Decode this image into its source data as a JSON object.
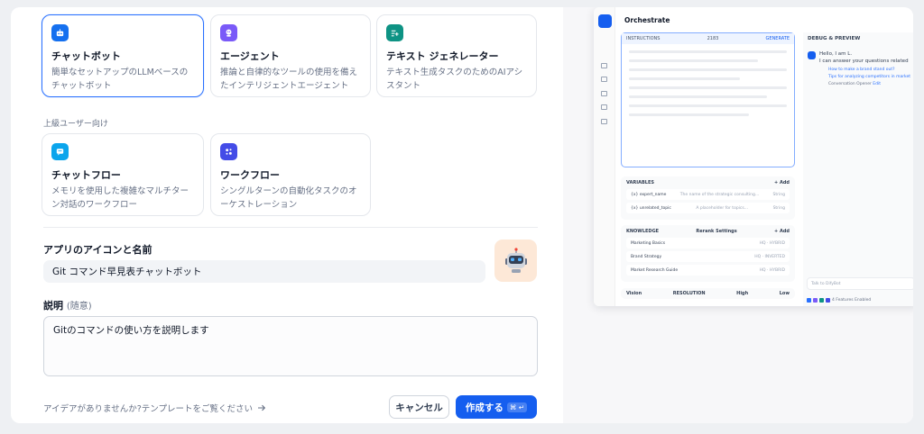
{
  "app_types": [
    {
      "title": "チャットボット",
      "desc": "簡単なセットアップのLLMベースのチャットボット",
      "color": "#1570ef",
      "icon": "chatbot-icon",
      "selected": true
    },
    {
      "title": "エージェント",
      "desc": "推論と自律的なツールの使用を備えたインテリジェントエージェント",
      "color": "#7a5af8",
      "icon": "agent-icon"
    },
    {
      "title": "テキスト ジェネレーター",
      "desc": "テキスト生成タスクのためのAIアシスタント",
      "color": "#0e9384",
      "icon": "text-generator-icon"
    }
  ],
  "advanced_label": "上級ユーザー向け",
  "advanced_types": [
    {
      "title": "チャットフロー",
      "desc": "メモリを使用した複雑なマルチターン対話のワークフロー",
      "color": "#0ba5ec",
      "icon": "chatflow-icon"
    },
    {
      "title": "ワークフロー",
      "desc": "シングルターンの自動化タスクのオーケストレーション",
      "color": "#444ce7",
      "icon": "workflow-icon"
    }
  ],
  "name_section": {
    "label": "アプリのアイコンと名前",
    "value": "Git コマンド早見表チャットボット",
    "icon_color": "#fde8d7"
  },
  "description_section": {
    "label": "説明",
    "optional": "(随意)",
    "value": "Gitのコマンドの使い方を説明します"
  },
  "footer": {
    "template_link": "アイデアがありませんか?テンプレートをご覧ください",
    "cancel": "キャンセル",
    "create": "作成する",
    "create_shortcut": "⌘ ↵",
    "accent": "#155eef"
  },
  "preview": {
    "title": "Orchestrate",
    "instructions": "INSTRUCTIONS",
    "instructions_count": "2183",
    "generate": "GENERATE",
    "variables_label": "VARIABLES",
    "add": "+ Add",
    "variables": [
      {
        "name": "{x} expert_name",
        "desc": "The name of the strategic consulting...",
        "type": "String"
      },
      {
        "name": "{x} unrelated_topic",
        "desc": "A placeholder for topics...",
        "type": "String"
      }
    ],
    "knowledge_label": "KNOWLEDGE",
    "rerank": "Rerank Settings",
    "knowledge": [
      {
        "name": "Marketing Basics",
        "tag": "HQ · HYBRID"
      },
      {
        "name": "Brand Strategy",
        "tag": "HQ · INVERTED"
      },
      {
        "name": "Market Research Guide",
        "tag": "HQ · HYBRID"
      }
    ],
    "vision": "Vision",
    "resolution": "RESOLUTION",
    "high": "High",
    "low": "Low",
    "debug_label": "DEBUG & PREVIEW",
    "greeting_1": "Hello, I am L.",
    "greeting_2": "I can answer your questions related",
    "suggestions": [
      "How to make a brand stand out?",
      "Tips for analyzing competitors in market"
    ],
    "opener": "Conversation Opener",
    "edit": "Edit",
    "input_placeholder": "Talk to DifyBot",
    "features": "4 Features Enabled"
  }
}
